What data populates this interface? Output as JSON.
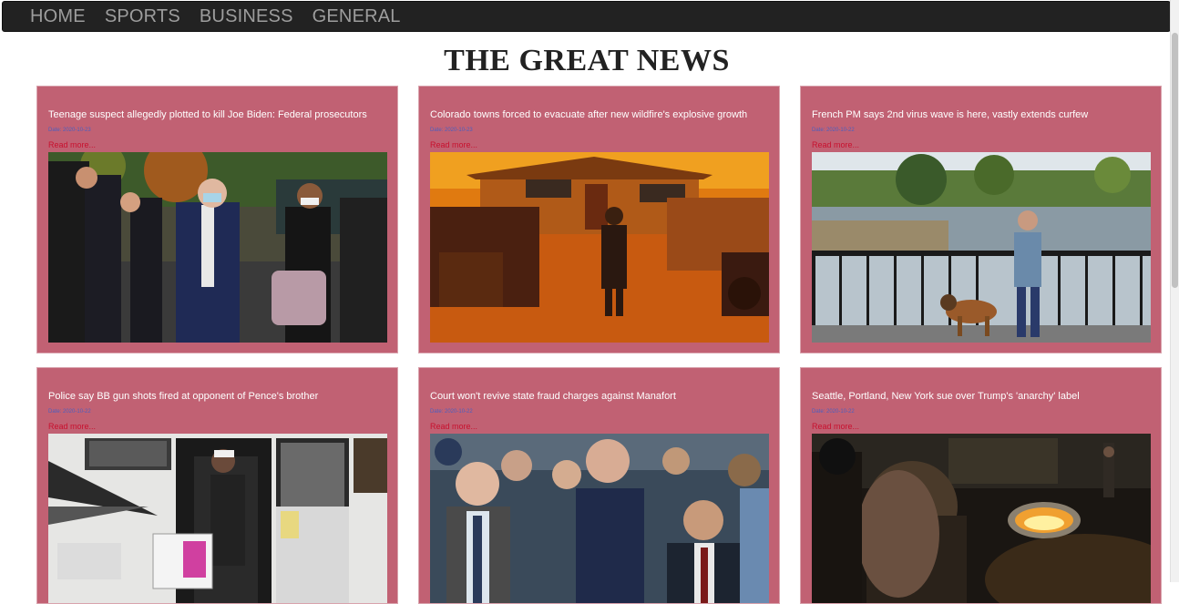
{
  "nav": {
    "items": [
      "HOME",
      "SPORTS",
      "BUSINESS",
      "GENERAL"
    ]
  },
  "page": {
    "title": "THE GREAT NEWS"
  },
  "articles": [
    {
      "title": "Teenage suspect allegedly plotted to kill Joe Biden: Federal prosecutors",
      "date": "Date: 2020-10-23",
      "more": "Read more...",
      "image": "biden-walking-photo"
    },
    {
      "title": "Colorado towns forced to evacuate after new wildfire's explosive growth",
      "date": "Date: 2020-10-23",
      "more": "Read more...",
      "image": "wildfire-house-photo"
    },
    {
      "title": "French PM says 2nd virus wave is here, vastly extends curfew",
      "date": "Date: 2020-10-22",
      "more": "Read more...",
      "image": "man-walking-dog-photo"
    },
    {
      "title": "Police say BB gun shots fired at opponent of Pence's brother",
      "date": "Date: 2020-10-22",
      "more": "Read more...",
      "image": "campaign-rv-photo"
    },
    {
      "title": "Court won't revive state fraud charges against Manafort",
      "date": "Date: 2020-10-22",
      "more": "Read more...",
      "image": "manafort-escorted-photo"
    },
    {
      "title": "Seattle, Portland, New York sue over Trump's 'anarchy' label",
      "date": "Date: 2020-10-22",
      "more": "Read more...",
      "image": "street-fire-protest-photo"
    }
  ],
  "colors": {
    "navbar": "#222222",
    "nav_text": "#9d9d9d",
    "card": "#c16173",
    "date_text": "#4b5fbf",
    "read_more": "#c8102e"
  }
}
